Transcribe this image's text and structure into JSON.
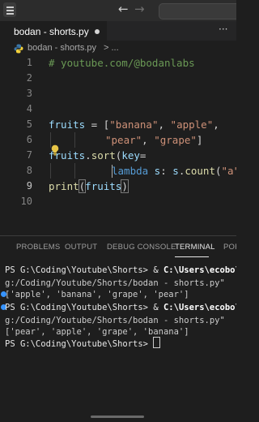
{
  "titlebar": {
    "back_icon": "arrow-left-icon",
    "forward_icon": "arrow-right-icon"
  },
  "tab": {
    "label": "bodan - shorts.py",
    "state": "unsaved",
    "more": "···"
  },
  "breadcrumb": {
    "file": "bodan - shorts.py",
    "more": "> ..."
  },
  "editor": {
    "line_numbers": [
      "1",
      "2",
      "3",
      "4",
      "5",
      "6",
      "7",
      "8",
      "9",
      "10"
    ],
    "current_line": "9",
    "lines": {
      "l1": {
        "comment": "# youtube.com/@bodanlabs"
      },
      "l5": {
        "var": "fruits",
        "eq": " = [",
        "s1": "\"banana\"",
        "c1": ", ",
        "s2": "\"apple\"",
        "c2": ","
      },
      "l6": {
        "s3": "\"pear\"",
        "c3": ", ",
        "s4": "\"grape\"",
        "end": "]"
      },
      "l7": {
        "var": "fruits",
        "dot": ".",
        "fn": "sort",
        "open": "(",
        "kw": "key",
        "eq": "="
      },
      "l8": {
        "kw": "lambda",
        "arg": " s",
        "colon": ": ",
        "var": "s",
        "dot": ".",
        "fn": "count",
        "open": "(",
        "str": "\"a\"",
        "close": "))"
      },
      "l9": {
        "fn": "print",
        "open": "(",
        "var": "fruits",
        "close": ")"
      }
    }
  },
  "panel": {
    "tabs": [
      "PROBLEMS",
      "OUTPUT",
      "DEBUG CONSOLE",
      "TERMINAL",
      "PORTS"
    ],
    "active_tab": "TERMINAL"
  },
  "terminal": {
    "lines": [
      {
        "prompt": "PS G:\\Coding\\Youtube\\Shorts>",
        "amp": " & ",
        "cmd": "C:\\Users\\ecobo\\"
      },
      {
        "text": "g:/Coding/Youtube/Shorts/bodan - shorts.py\""
      },
      {
        "text": "['apple', 'banana', 'grape', 'pear']"
      },
      {
        "prompt": "PS G:\\Coding\\Youtube\\Shorts>",
        "amp": " & ",
        "cmd": "C:\\Users\\ecobo\\"
      },
      {
        "text": "g:/Coding/Youtube/Shorts/bodan - shorts.py\""
      },
      {
        "text": "['pear', 'apple', 'grape', 'banana']"
      },
      {
        "prompt": "PS G:\\Coding\\Youtube\\Shorts>"
      }
    ]
  },
  "colors": {
    "editor_bg": "#1e1e1e",
    "comment": "#6a9955",
    "variable": "#9cdcfe",
    "string": "#ce9178",
    "function": "#dcdcaa",
    "keyword": "#569cd6",
    "terminal_dot": "#3794ff"
  }
}
